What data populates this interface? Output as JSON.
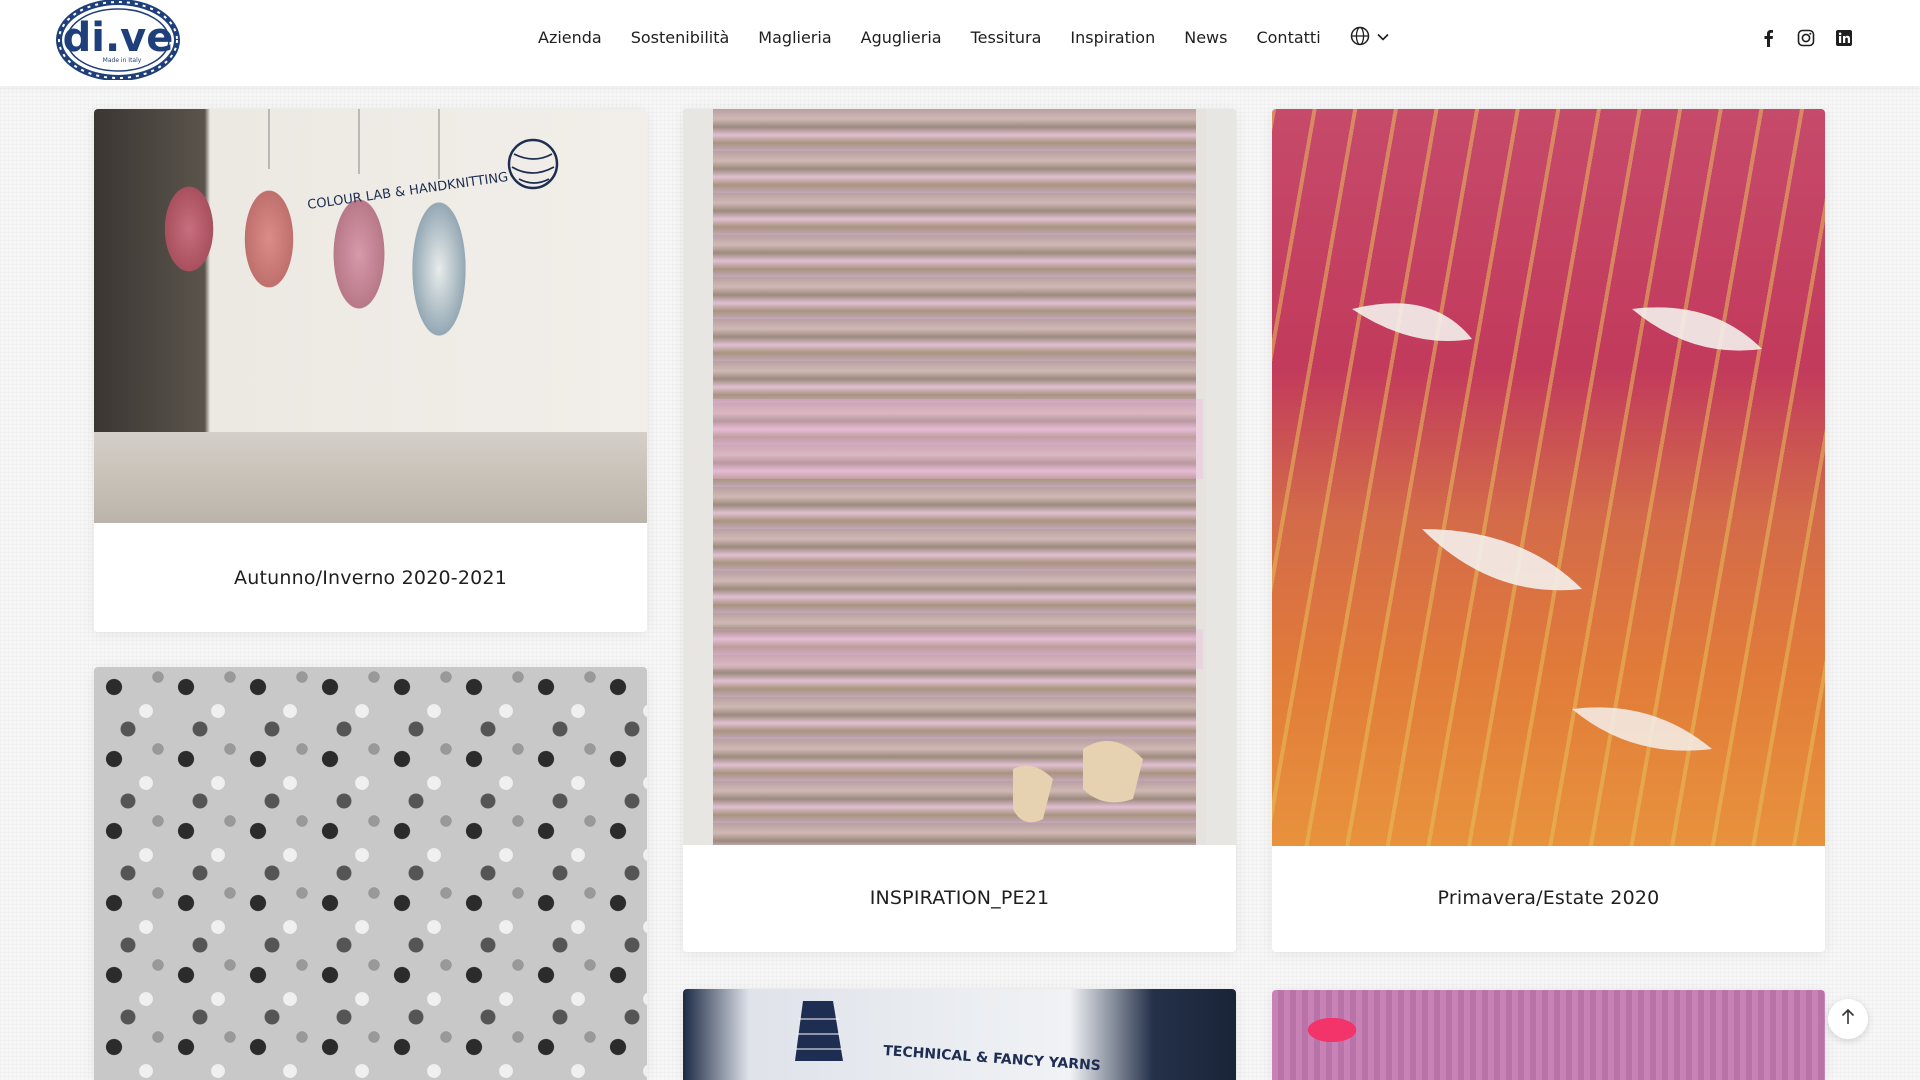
{
  "brand": {
    "name": "di.ve",
    "tagline": "Made in Italy"
  },
  "nav": {
    "items": [
      {
        "label": "Azienda"
      },
      {
        "label": "Sostenibilità"
      },
      {
        "label": "Maglieria"
      },
      {
        "label": "Aguglieria"
      },
      {
        "label": "Tessitura"
      },
      {
        "label": "Inspiration"
      },
      {
        "label": "News"
      },
      {
        "label": "Contatti"
      }
    ],
    "language_icon": "globe-icon",
    "language_dropdown_icon": "chevron-down-icon"
  },
  "social": [
    {
      "icon": "facebook-icon"
    },
    {
      "icon": "instagram-icon"
    },
    {
      "icon": "linkedin-icon"
    }
  ],
  "gallery": {
    "cards": [
      {
        "caption": "Autunno/Inverno 2020-2021",
        "image_text": "COLOUR LAB & HANDKNITTING"
      },
      {
        "caption": "INSPIRATION_PE21"
      },
      {
        "caption": "Primavera/Estate 2020"
      },
      {
        "caption": ""
      },
      {
        "caption": "",
        "image_text": "TECHNICAL & FANCY YARNS"
      },
      {
        "caption": ""
      }
    ]
  },
  "colors": {
    "header_bg": "#ffffff",
    "logo_blue": "#1e3f7a",
    "text": "#1f1f1f",
    "page_bg": "#f7f7f7"
  },
  "scroll_top_icon": "arrow-up-icon"
}
